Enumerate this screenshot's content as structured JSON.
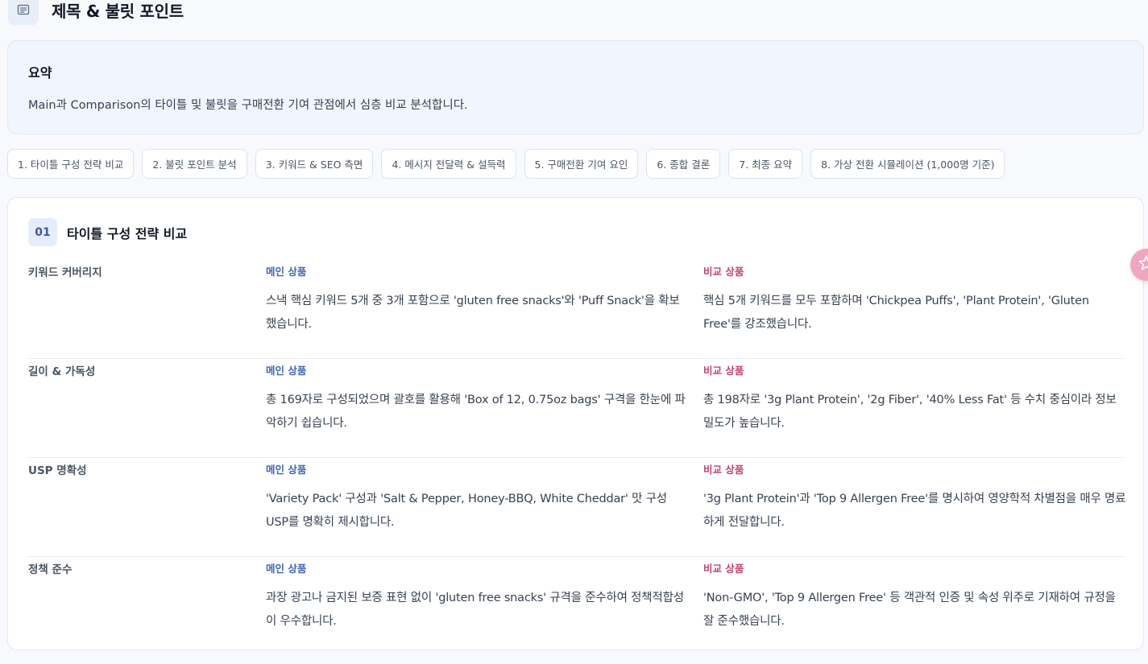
{
  "header": {
    "title": "제목 & 불릿 포인트",
    "icon": "document-icon"
  },
  "summary": {
    "heading": "요약",
    "text": "Main과 Comparison의 타이틀 및 불릿을 구매전환 기여 관점에서 심층 비교 분석합니다."
  },
  "tabs": [
    {
      "label": "1. 타이틀 구성 전략 비교"
    },
    {
      "label": "2. 불릿 포인트 분석"
    },
    {
      "label": "3. 키워드 & SEO 측면"
    },
    {
      "label": "4. 메시지 전달력 & 설득력"
    },
    {
      "label": "5. 구매전환 기여 요인"
    },
    {
      "label": "6. 종합 결론"
    },
    {
      "label": "7. 최종 요약"
    },
    {
      "label": "8. 가상 전환 시뮬레이션 (1,000명 기준)"
    }
  ],
  "section": {
    "number": "01",
    "title": "타이틀 구성 전략 비교",
    "main_tag": "메인 상품",
    "comp_tag": "비교 상품",
    "rows": [
      {
        "label": "키워드 커버리지",
        "main": "스낵 핵심 키워드 5개 중 3개 포함으로 'gluten free snacks'와 'Puff Snack'을 확보했습니다.",
        "comp": "핵심 5개 키워드를 모두 포함하며 'Chickpea Puffs', 'Plant Protein', 'Gluten Free'를 강조했습니다."
      },
      {
        "label": "길이 & 가독성",
        "main": "총 169자로 구성되었으며 괄호를 활용해 'Box of 12, 0.75oz bags' 구격을 한눈에 파악하기 쉽습니다.",
        "comp": "총 198자로 '3g Plant Protein', '2g Fiber', '40% Less Fat' 등 수치 중심이라 정보 밀도가 높습니다."
      },
      {
        "label": "USP 명확성",
        "main": "'Variety Pack' 구성과 'Salt & Pepper, Honey-BBQ, White Cheddar' 맛 구성 USP를 명확히 제시합니다.",
        "comp": "'3g Plant Protein'과 'Top 9 Allergen Free'를 명시하여 영양학적 차별점을 매우 명료하게 전달합니다."
      },
      {
        "label": "정책 준수",
        "main": "과장 광고나 금지된 보증 표현 없이 'gluten free snacks' 규격을 준수하여 정책적합성이 우수합니다.",
        "comp": "'Non-GMO', 'Top 9 Allergen Free' 등 객관적 인증 및 속성 위주로 기재하여 규정을 잘 준수했습니다."
      }
    ]
  },
  "floating_button": {
    "icon": "sparkle-star-icon"
  },
  "colors": {
    "main_accent": "#3f66b6",
    "comp_accent": "#c0456a",
    "summary_bg": "#f1f5fd"
  }
}
